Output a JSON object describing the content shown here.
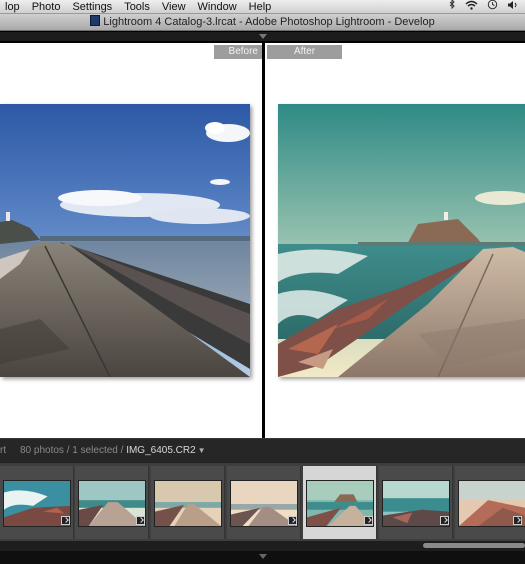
{
  "menubar": {
    "items": [
      "lop",
      "Photo",
      "Settings",
      "Tools",
      "View",
      "Window",
      "Help"
    ],
    "status_icons": [
      "bluetooth-icon",
      "wifi-icon",
      "time-machine-icon",
      "volume-icon"
    ]
  },
  "window": {
    "title": "Lightroom 4 Catalog-3.lrcat - Adobe Photoshop Lightroom - Develop"
  },
  "compare": {
    "before_label": "Before",
    "after_label": "After"
  },
  "filmstrip_bar": {
    "source_fragment": "rt",
    "count_text": "80 photos / 1 selected /",
    "filename": "IMG_6405.CR2",
    "dropdown_caret": "▼"
  },
  "filmstrip": {
    "selected_index": 4,
    "thumbnail_count": 7
  },
  "colors": {
    "panel_dark": "#1c1c1c",
    "filmstrip_bg": "#3e3e3e",
    "selected_cell": "#d6d6d6",
    "label_bg": "#9d9d9d"
  }
}
